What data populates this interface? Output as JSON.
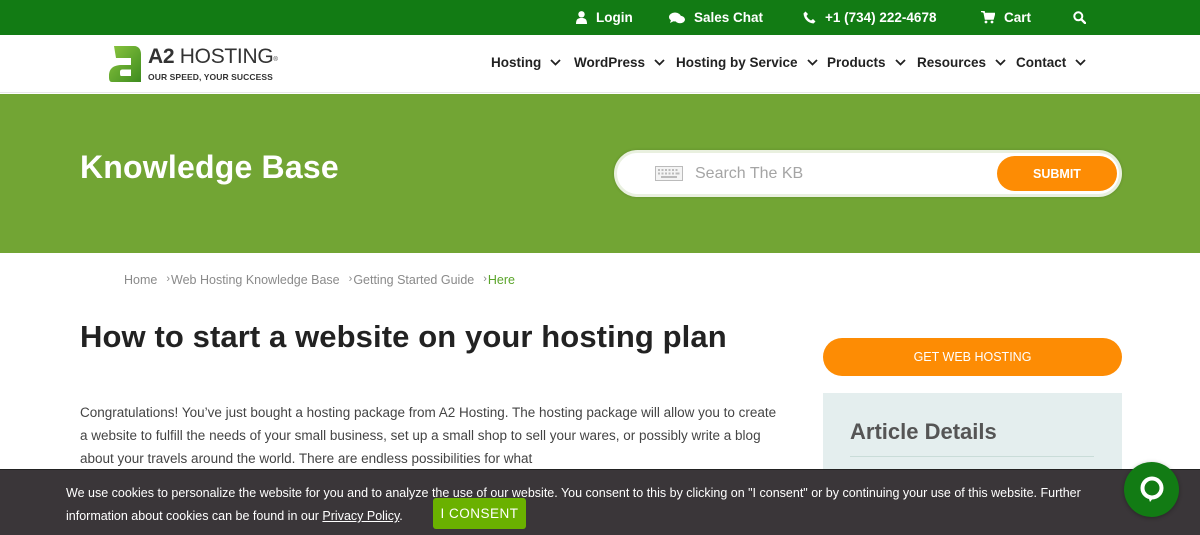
{
  "topbar": {
    "login": "Login",
    "sales_chat": "Sales Chat",
    "phone": "+1 (734) 222-4678",
    "cart": "Cart",
    "icons": [
      "user-icon",
      "chat-bubbles-icon",
      "phone-icon",
      "cart-icon",
      "search-icon"
    ]
  },
  "header": {
    "logo_brand": "A2",
    "logo_name": "HOSTING",
    "logo_mark": "®",
    "logo_tagline": "OUR SPEED, YOUR SUCCESS",
    "nav": [
      {
        "label": "Hosting"
      },
      {
        "label": "WordPress"
      },
      {
        "label": "Hosting by Service"
      },
      {
        "label": "Products"
      },
      {
        "label": "Resources"
      },
      {
        "label": "Contact"
      }
    ]
  },
  "hero": {
    "title": "Knowledge Base",
    "search_placeholder": "Search The KB",
    "search_value": "",
    "submit_label": "SUBMIT"
  },
  "breadcrumb": {
    "separator": "›",
    "items": [
      "Home",
      "Web Hosting Knowledge Base",
      "Getting Started Guide",
      "Here"
    ]
  },
  "article": {
    "title": "How to start a website on your hosting plan",
    "body": "Congratulations! You’ve just bought a hosting package from A2 Hosting. The hosting package will allow you to create a website to fulfill the needs of your small business, set up a small shop to sell your wares, or possibly write a blog about your travels around the world. There are endless possibilities for what"
  },
  "sidebar": {
    "cta_label": "GET WEB HOSTING",
    "details_title": "Article Details"
  },
  "cookie": {
    "text": "We use cookies to personalize the website for you and to analyze the use of our website. You consent to this by clicking on \"I consent\" or by continuing your use of this website. Further information about cookies can be found in our ",
    "link": "Privacy Policy",
    "suffix": ".",
    "consent_label": "I CONSENT"
  },
  "colors": {
    "topbar": "#127b14",
    "hero": "#72a534",
    "accent_orange": "#fd8c04",
    "consent_green": "#6ab100",
    "cookie_bg": "#3a3639",
    "breadcrumb_current": "#5aa52a"
  }
}
